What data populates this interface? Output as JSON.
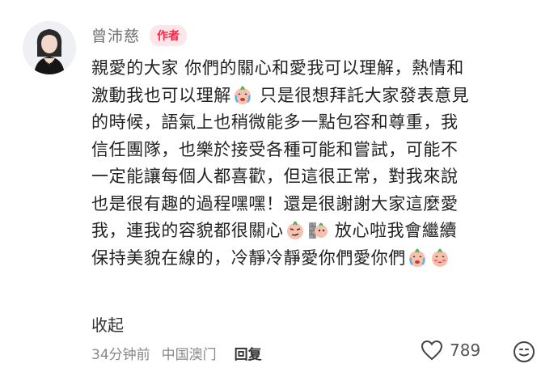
{
  "author": {
    "name": "曾沛慈",
    "badge": "作者"
  },
  "comment": {
    "lines": [
      [
        {
          "t": "親愛的大家 你們的關心和愛我可以理解，熱情和"
        }
      ],
      [
        {
          "t": "激動我也可以理解"
        },
        {
          "e": "crying-face-emoji"
        },
        {
          "t": " 只是很想拜託大家發表意見"
        }
      ],
      [
        {
          "t": "的時候，語氣上也稍微能多一點包容和尊重，我"
        }
      ],
      [
        {
          "t": "信任團隊，也樂於接受各種可能和嘗試，可能不"
        }
      ],
      [
        {
          "t": "一定能讓每個人都喜歡，但這很正常，對我來說"
        }
      ],
      [
        {
          "t": "也是很有趣的過程嘿嘿！還是很謝謝大家這麼愛"
        }
      ],
      [
        {
          "t": "我，連我的容貌都很關心"
        },
        {
          "e": "smirk-face-emoji"
        },
        {
          "e": "wall-peek-emoji"
        },
        {
          "t": " 放心啦我會繼續"
        }
      ],
      [
        {
          "t": "保持美貌在線的，冷靜冷靜愛你們愛你們"
        },
        {
          "e": "crying-face-emoji"
        },
        {
          "e": "blush-face-emoji"
        }
      ]
    ],
    "collapse_label": "收起"
  },
  "footer": {
    "time": "34分钟前",
    "location": "中国澳门",
    "reply_label": "回复",
    "like_count": "789"
  },
  "colors": {
    "badge_text": "#ff2442",
    "badge_bg": "#fde6ea",
    "muted_text": "#888888"
  }
}
